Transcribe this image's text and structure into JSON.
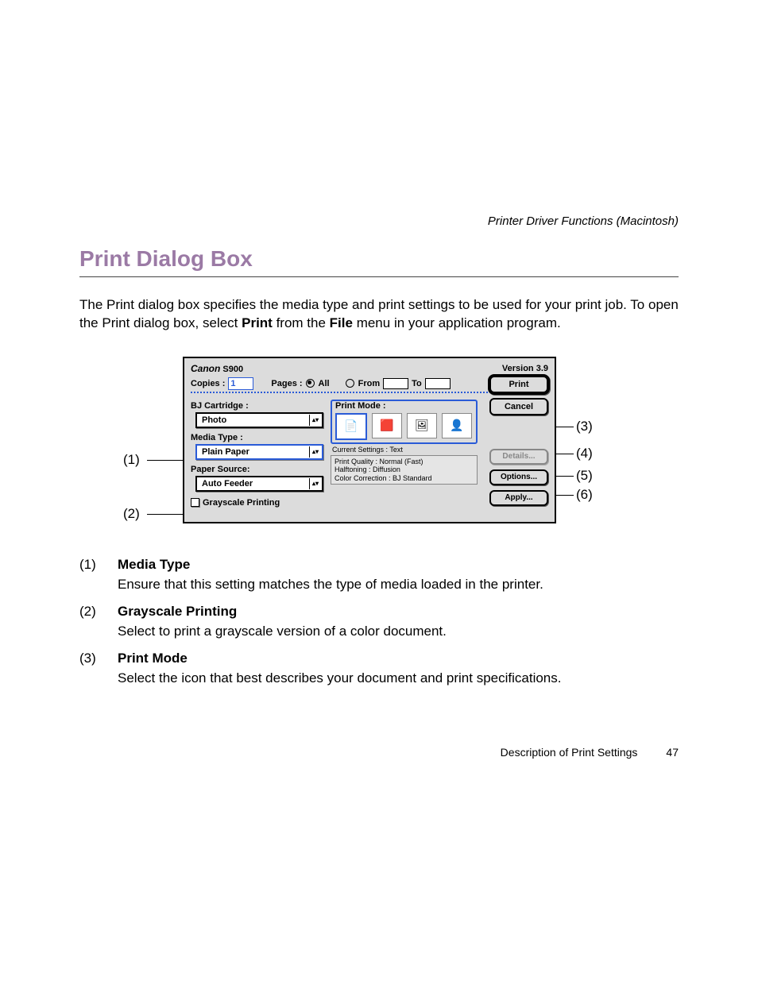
{
  "header": {
    "section": "Printer Driver Functions (Macintosh)",
    "title": "Print Dialog Box",
    "intro_1": "The Print dialog box specifies the media type and print settings to be used for your print job. To open the Print dialog box, select ",
    "intro_b1": "Print",
    "intro_2": " from the ",
    "intro_b2": "File",
    "intro_3": " menu in your application program."
  },
  "dialog": {
    "brand": "Canon",
    "model": "S900",
    "version": "Version 3.9",
    "copies_label": "Copies :",
    "copies_value": "1",
    "pages_label": "Pages :",
    "pages_all": "All",
    "pages_from": "From",
    "pages_to": "To",
    "bj_cartridge_label": "BJ Cartridge :",
    "bj_cartridge_value": "Photo",
    "media_type_label": "Media Type :",
    "media_type_value": "Plain Paper",
    "paper_source_label": "Paper Source:",
    "paper_source_value": "Auto Feeder",
    "grayscale_label": "Grayscale Printing",
    "print_mode_label": "Print Mode :",
    "current_settings_label": "Current Settings : Text",
    "details": {
      "quality": "Print Quality : Normal (Fast)",
      "halftoning": "Halftoning : Diffusion",
      "color": "Color Correction : BJ Standard"
    },
    "buttons": {
      "print": "Print",
      "cancel": "Cancel",
      "details_btn": "Details...",
      "options": "Options...",
      "apply": "Apply..."
    }
  },
  "callouts": {
    "c1": "(1)",
    "c2": "(2)",
    "c3": "(3)",
    "c4": "(4)",
    "c5": "(5)",
    "c6": "(6)"
  },
  "definitions": [
    {
      "num": "(1)",
      "title": "Media Type",
      "desc": "Ensure that this setting matches the type of media loaded in the printer."
    },
    {
      "num": "(2)",
      "title": "Grayscale Printing",
      "desc": "Select to print a grayscale version of a color document."
    },
    {
      "num": "(3)",
      "title": "Print Mode",
      "desc": "Select the icon that best describes your document and print specifications."
    }
  ],
  "footer": {
    "section": "Description of Print Settings",
    "page": "47"
  }
}
